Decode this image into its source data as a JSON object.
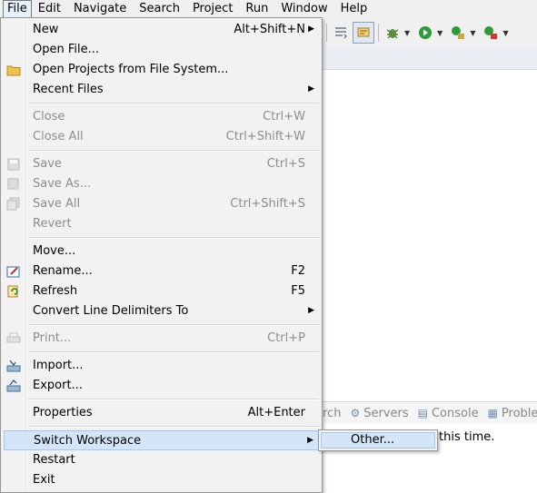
{
  "menubar": {
    "items": [
      "File",
      "Edit",
      "Navigate",
      "Search",
      "Project",
      "Run",
      "Window",
      "Help"
    ]
  },
  "file_menu": {
    "groups": [
      [
        {
          "label": "New",
          "shortcut": "Alt+Shift+N",
          "submenu": true,
          "enabled": true,
          "icon": ""
        },
        {
          "label": "Open File...",
          "shortcut": "",
          "submenu": false,
          "enabled": true,
          "icon": ""
        },
        {
          "label": "Open Projects from File System...",
          "shortcut": "",
          "submenu": false,
          "enabled": true,
          "icon": "folder-icon"
        },
        {
          "label": "Recent Files",
          "shortcut": "",
          "submenu": true,
          "enabled": true,
          "icon": ""
        }
      ],
      [
        {
          "label": "Close",
          "shortcut": "Ctrl+W",
          "submenu": false,
          "enabled": false,
          "icon": ""
        },
        {
          "label": "Close All",
          "shortcut": "Ctrl+Shift+W",
          "submenu": false,
          "enabled": false,
          "icon": ""
        }
      ],
      [
        {
          "label": "Save",
          "shortcut": "Ctrl+S",
          "submenu": false,
          "enabled": false,
          "icon": "save-icon"
        },
        {
          "label": "Save As...",
          "shortcut": "",
          "submenu": false,
          "enabled": false,
          "icon": "save-as-icon"
        },
        {
          "label": "Save All",
          "shortcut": "Ctrl+Shift+S",
          "submenu": false,
          "enabled": false,
          "icon": "save-all-icon"
        },
        {
          "label": "Revert",
          "shortcut": "",
          "submenu": false,
          "enabled": false,
          "icon": ""
        }
      ],
      [
        {
          "label": "Move...",
          "shortcut": "",
          "submenu": false,
          "enabled": true,
          "icon": ""
        },
        {
          "label": "Rename...",
          "shortcut": "F2",
          "submenu": false,
          "enabled": true,
          "icon": "rename-icon"
        },
        {
          "label": "Refresh",
          "shortcut": "F5",
          "submenu": false,
          "enabled": true,
          "icon": "refresh-icon"
        },
        {
          "label": "Convert Line Delimiters To",
          "shortcut": "",
          "submenu": true,
          "enabled": true,
          "icon": ""
        }
      ],
      [
        {
          "label": "Print...",
          "shortcut": "Ctrl+P",
          "submenu": false,
          "enabled": false,
          "icon": "print-icon"
        }
      ],
      [
        {
          "label": "Import...",
          "shortcut": "",
          "submenu": false,
          "enabled": true,
          "icon": "import-icon"
        },
        {
          "label": "Export...",
          "shortcut": "",
          "submenu": false,
          "enabled": true,
          "icon": "export-icon"
        }
      ],
      [
        {
          "label": "Properties",
          "shortcut": "Alt+Enter",
          "submenu": false,
          "enabled": true,
          "icon": ""
        }
      ],
      [
        {
          "label": "Switch Workspace",
          "shortcut": "",
          "submenu": true,
          "enabled": true,
          "icon": "",
          "highlighted": true
        },
        {
          "label": "Restart",
          "shortcut": "",
          "submenu": false,
          "enabled": true,
          "icon": ""
        },
        {
          "label": "Exit",
          "shortcut": "",
          "submenu": false,
          "enabled": true,
          "icon": ""
        }
      ]
    ]
  },
  "switch_workspace_submenu": {
    "items": [
      "Other..."
    ]
  },
  "toolbar": {
    "icons": [
      "toolbar-list-icon",
      "toolbar-highlight-icon",
      "debug-icon",
      "run-icon",
      "coverage-icon",
      "external-tool-icon"
    ]
  },
  "bottom_panel": {
    "tabs": [
      {
        "label": "rch",
        "icon": ""
      },
      {
        "label": "Servers",
        "icon": "servers-icon"
      },
      {
        "label": "Console",
        "icon": "console-icon"
      },
      {
        "label": "Proble",
        "icon": "problems-icon"
      }
    ],
    "console_text": "this time."
  },
  "colors": {
    "menu_bg": "#f2f2f2",
    "highlight": "#d4e5f8",
    "disabled_text": "#8d8d8d"
  }
}
